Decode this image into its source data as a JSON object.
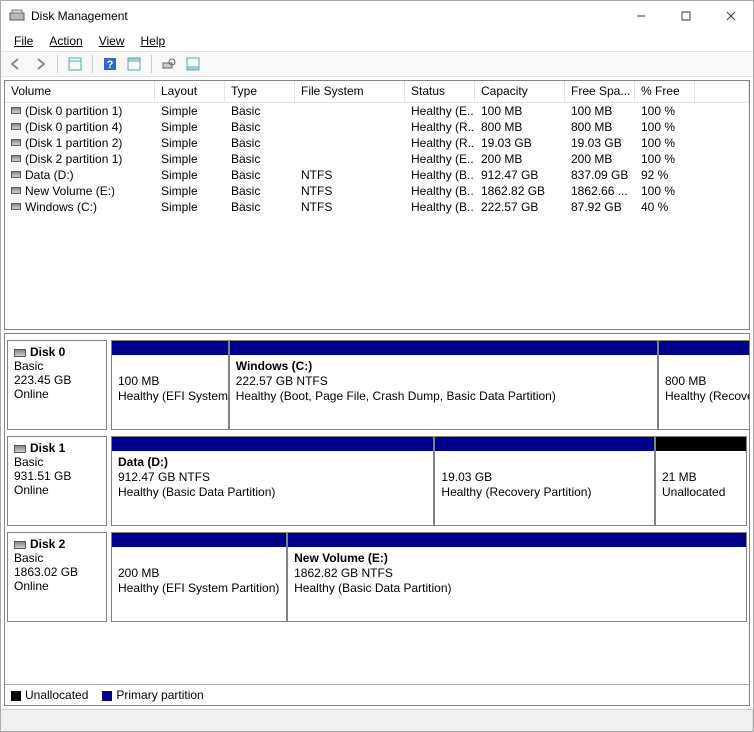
{
  "window": {
    "title": "Disk Management"
  },
  "menus": {
    "file": "File",
    "action": "Action",
    "view": "View",
    "help": "Help"
  },
  "volume_columns": {
    "volume": "Volume",
    "layout": "Layout",
    "type": "Type",
    "fs": "File System",
    "status": "Status",
    "capacity": "Capacity",
    "free": "Free Spa...",
    "pct": "% Free"
  },
  "volumes": [
    {
      "name": "(Disk 0 partition 1)",
      "layout": "Simple",
      "type": "Basic",
      "fs": "",
      "status": "Healthy (E...",
      "capacity": "100 MB",
      "free": "100 MB",
      "pct": "100 %"
    },
    {
      "name": "(Disk 0 partition 4)",
      "layout": "Simple",
      "type": "Basic",
      "fs": "",
      "status": "Healthy (R...",
      "capacity": "800 MB",
      "free": "800 MB",
      "pct": "100 %"
    },
    {
      "name": "(Disk 1 partition 2)",
      "layout": "Simple",
      "type": "Basic",
      "fs": "",
      "status": "Healthy (R...",
      "capacity": "19.03 GB",
      "free": "19.03 GB",
      "pct": "100 %"
    },
    {
      "name": "(Disk 2 partition 1)",
      "layout": "Simple",
      "type": "Basic",
      "fs": "",
      "status": "Healthy (E...",
      "capacity": "200 MB",
      "free": "200 MB",
      "pct": "100 %"
    },
    {
      "name": "Data (D:)",
      "layout": "Simple",
      "type": "Basic",
      "fs": "NTFS",
      "status": "Healthy (B...",
      "capacity": "912.47 GB",
      "free": "837.09 GB",
      "pct": "92 %"
    },
    {
      "name": "New Volume (E:)",
      "layout": "Simple",
      "type": "Basic",
      "fs": "NTFS",
      "status": "Healthy (B...",
      "capacity": "1862.82 GB",
      "free": "1862.66 ...",
      "pct": "100 %"
    },
    {
      "name": "Windows (C:)",
      "layout": "Simple",
      "type": "Basic",
      "fs": "NTFS",
      "status": "Healthy (B...",
      "capacity": "222.57 GB",
      "free": "87.92 GB",
      "pct": "40 %"
    }
  ],
  "disks": [
    {
      "name": "Disk 0",
      "type": "Basic",
      "size": "223.45 GB",
      "status": "Online",
      "parts": [
        {
          "stripe": "primary",
          "flex": 13,
          "title": "",
          "sub": "100 MB",
          "desc": "Healthy (EFI System Partition)"
        },
        {
          "stripe": "primary",
          "flex": 48,
          "title": "Windows  (C:)",
          "sub": "222.57 GB NTFS",
          "desc": "Healthy (Boot, Page File, Crash Dump, Basic Data Partition)"
        },
        {
          "stripe": "primary",
          "flex": 14,
          "title": "",
          "sub": "800 MB",
          "desc": "Healthy (Recovery Partition)"
        }
      ]
    },
    {
      "name": "Disk 1",
      "type": "Basic",
      "size": "931.51 GB",
      "status": "Online",
      "parts": [
        {
          "stripe": "primary",
          "flex": 50,
          "title": "Data  (D:)",
          "sub": "912.47 GB NTFS",
          "desc": "Healthy (Basic Data Partition)"
        },
        {
          "stripe": "primary",
          "flex": 34,
          "title": "",
          "sub": "19.03 GB",
          "desc": "Healthy (Recovery Partition)"
        },
        {
          "stripe": "unalloc",
          "flex": 14,
          "title": "",
          "sub": "21 MB",
          "desc": "Unallocated"
        }
      ]
    },
    {
      "name": "Disk 2",
      "type": "Basic",
      "size": "1863.02 GB",
      "status": "Online",
      "parts": [
        {
          "stripe": "primary",
          "flex": 27,
          "title": "",
          "sub": "200 MB",
          "desc": "Healthy (EFI System Partition)"
        },
        {
          "stripe": "primary",
          "flex": 71,
          "title": "New Volume  (E:)",
          "sub": "1862.82 GB NTFS",
          "desc": "Healthy (Basic Data Partition)"
        }
      ]
    }
  ],
  "legend": {
    "unallocated": "Unallocated",
    "primary": "Primary partition"
  },
  "colors": {
    "primary_stripe": "#00008b",
    "unallocated_stripe": "#000000"
  }
}
